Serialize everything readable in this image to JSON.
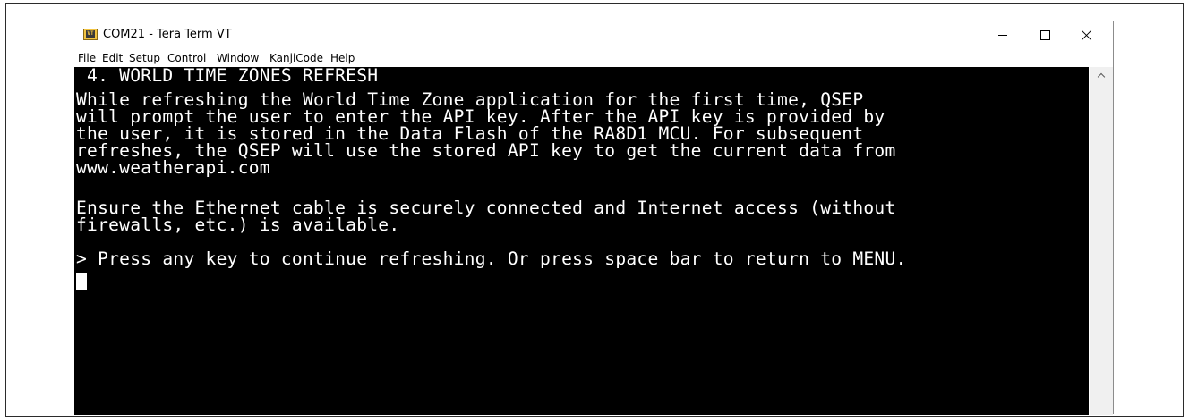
{
  "window": {
    "title": "COM21 - Tera Term VT",
    "icon": "tera-term-icon",
    "icon_label": "VT"
  },
  "menu": {
    "items": [
      {
        "label": "File",
        "mnemonic": "F"
      },
      {
        "label": "Edit",
        "mnemonic": "E"
      },
      {
        "label": "Setup",
        "mnemonic": "S"
      },
      {
        "label": "Control",
        "mnemonic": "o"
      },
      {
        "label": "Window",
        "mnemonic": "W"
      },
      {
        "label": "KanjiCode",
        "mnemonic": "K"
      },
      {
        "label": "Help",
        "mnemonic": "H"
      }
    ]
  },
  "terminal": {
    "lines": [
      " 4. WORLD TIME ZONES REFRESH",
      "",
      "While refreshing the World Time Zone application for the first time, QSEP",
      "will prompt the user to enter the API key. After the API key is provided by",
      "the user, it is stored in the Data Flash of the RA8D1 MCU. For subsequent",
      "refreshes, the QSEP will use the stored API key to get the current data from",
      "www.weatherapi.com",
      "",
      "Ensure the Ethernet cable is securely connected and Internet access (without",
      "firewalls, etc.) is available.",
      "",
      "> Press any key to continue refreshing. Or press space bar to return to MENU."
    ],
    "background": "#000000",
    "foreground": "#ffffff"
  },
  "controls": {
    "minimize": "minimize-icon",
    "maximize": "maximize-icon",
    "close": "close-icon",
    "scroll_up": "chevron-up-icon"
  }
}
